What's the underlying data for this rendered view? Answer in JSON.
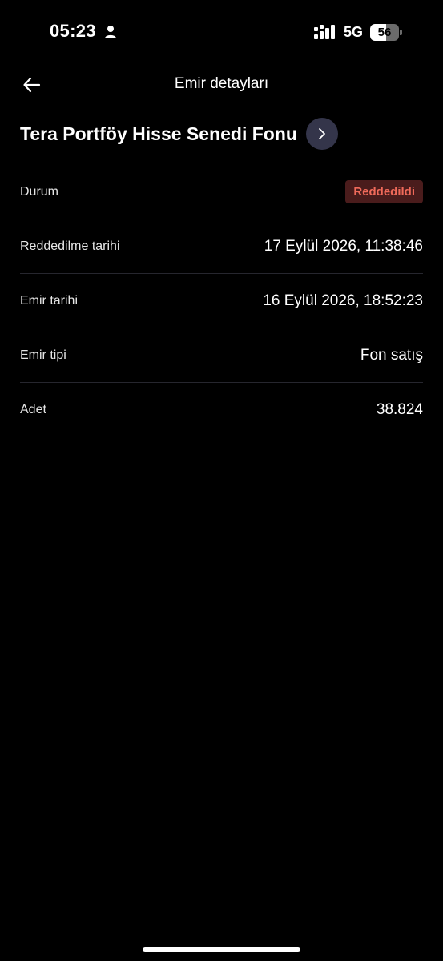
{
  "status_bar": {
    "time": "05:23",
    "network": "5G",
    "battery": "56",
    "battery_level_percent": 56
  },
  "header": {
    "title": "Emir detayları",
    "back_icon": "arrow-left-icon"
  },
  "fund": {
    "name": "Tera Portföy Hisse Senedi Fonu",
    "chevron_icon": "chevron-right-icon"
  },
  "details": [
    {
      "label": "Durum",
      "value": "Reddedildi"
    },
    {
      "label": "Reddedilme tarihi",
      "value": "17 Eylül 2026, 11:38:46"
    },
    {
      "label": "Emir tarihi",
      "value": "16 Eylül 2026, 18:52:23"
    },
    {
      "label": "Emir tipi",
      "value": "Fon satış"
    },
    {
      "label": "Adet",
      "value": "38.824"
    }
  ],
  "colors": {
    "background": "#000000",
    "status_rejected_text": "#f06a5a",
    "status_rejected_bg": "#4a1c1c",
    "chevron_bg": "#34354a",
    "divider": "#26262e"
  }
}
